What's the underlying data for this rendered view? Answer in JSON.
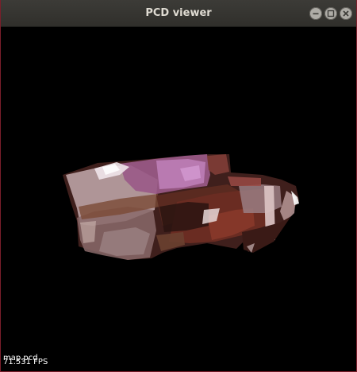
{
  "window": {
    "title": "PCD viewer"
  },
  "overlay": {
    "fps": "71.531 FPS",
    "cloud_name": "map.pcd"
  },
  "colors": {
    "titlebar": "#3c3b37",
    "title_text": "#dfdbd2",
    "background": "#000000",
    "window_border": "#7a1e2a"
  }
}
